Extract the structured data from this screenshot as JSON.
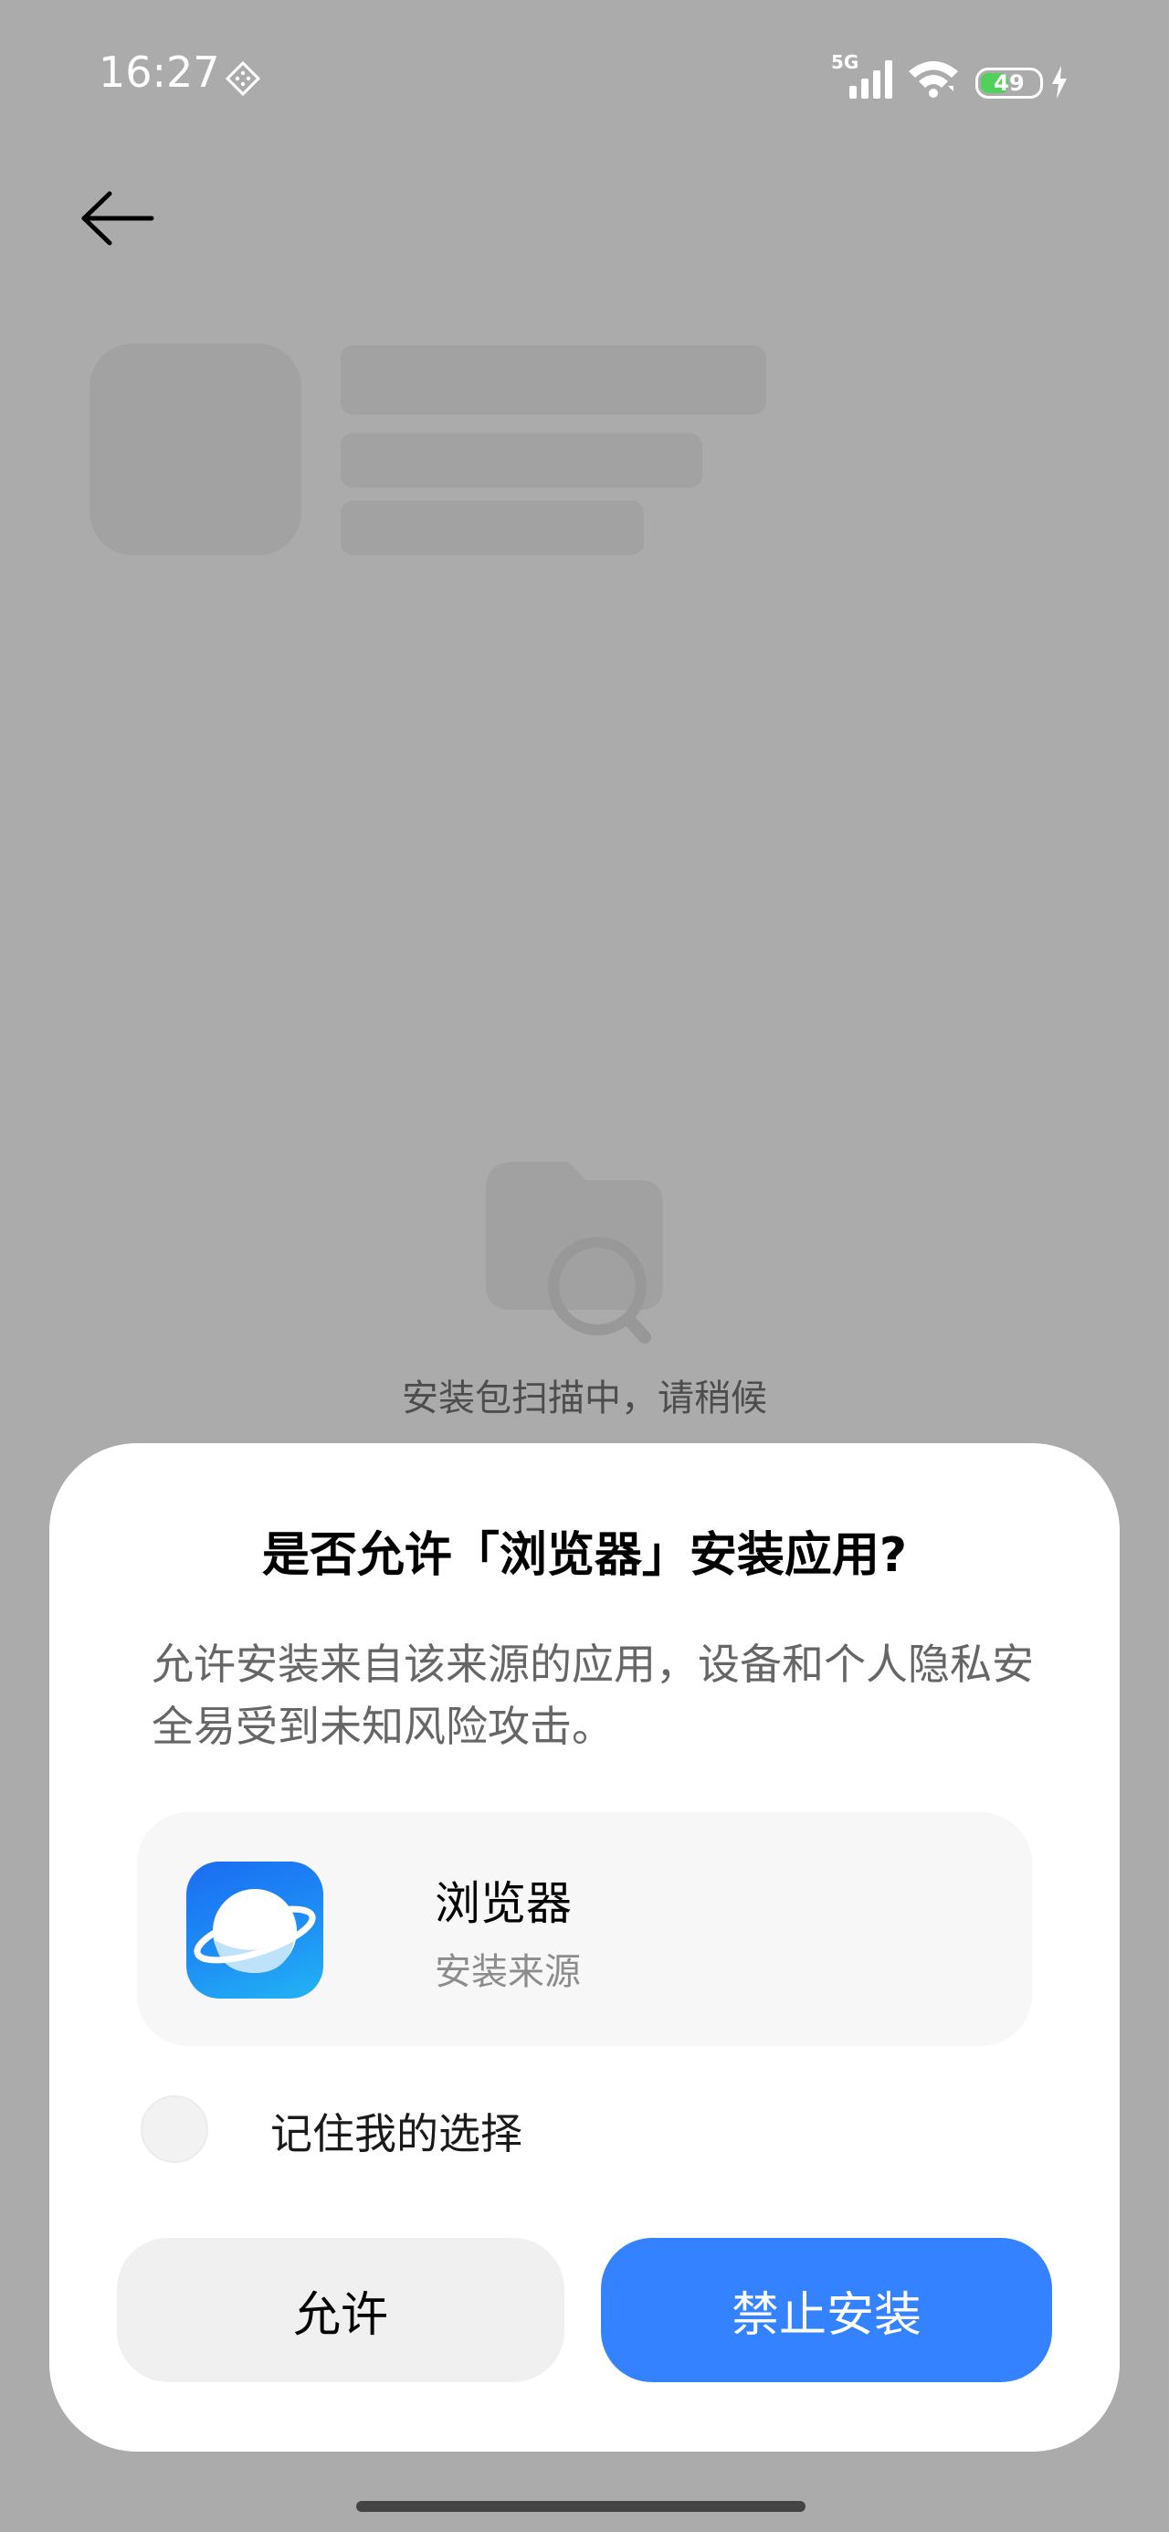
{
  "status_bar": {
    "time": "16:27",
    "network": "5G",
    "battery": "49",
    "battery_level_percent": 49
  },
  "background_page": {
    "scan_status": "安装包扫描中，请稍候"
  },
  "dialog": {
    "title": "是否允许「浏览器」安装应用?",
    "message": "允许安装来自该来源的应用，设备和个人隐私安全易受到未知风险攻击。",
    "app": {
      "name": "浏览器",
      "subtitle": "安装来源",
      "icon": "browser-planet-icon"
    },
    "remember_label": "记住我的选择",
    "remember_checked": false,
    "allow_label": "允许",
    "deny_label": "禁止安装"
  },
  "colors": {
    "overlay": "#ababab",
    "primary_button": "#3482ff",
    "secondary_button": "#f0f0f0",
    "battery_green": "#52d15a"
  }
}
